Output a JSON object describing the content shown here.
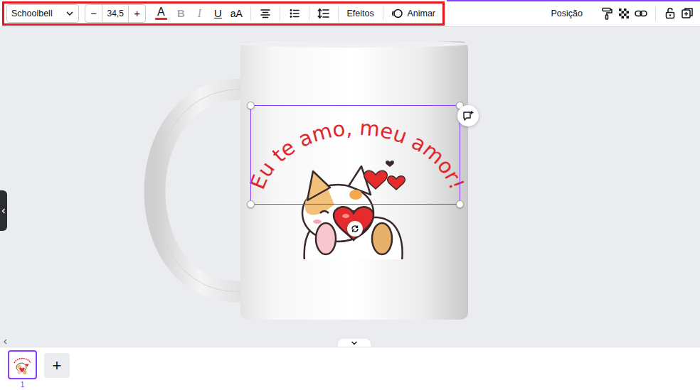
{
  "toolbar": {
    "highlighted": true,
    "font": "Schoolbell",
    "decrease": "−",
    "font_size": "34,5",
    "increase": "+",
    "text_color_label": "A",
    "text_color": "#e0262d",
    "styles": [
      {
        "label": "B",
        "disabled": true,
        "kind": "bold"
      },
      {
        "label": "I",
        "disabled": true,
        "kind": "italic"
      },
      {
        "label": "U",
        "disabled": false,
        "kind": "underline"
      },
      {
        "label": "aA",
        "disabled": false,
        "kind": "case"
      }
    ],
    "effects": "Efeitos",
    "animate": "Animar"
  },
  "position": "Posição",
  "canvas": {
    "text": "Eu te amo, meu amor!",
    "text_selected": true
  },
  "pages": [
    {
      "number": "1",
      "selected": true
    }
  ],
  "add_page": "+"
}
